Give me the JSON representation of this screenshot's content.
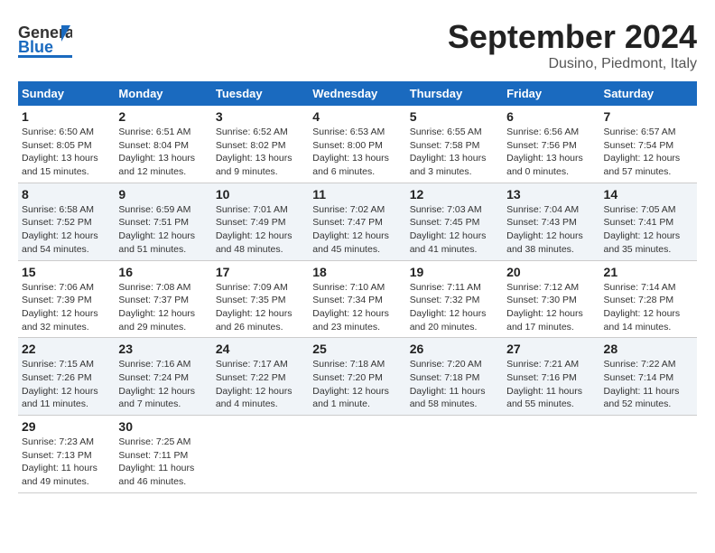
{
  "header": {
    "logo_general": "General",
    "logo_blue": "Blue",
    "month_title": "September 2024",
    "location": "Dusino, Piedmont, Italy"
  },
  "days_of_week": [
    "Sunday",
    "Monday",
    "Tuesday",
    "Wednesday",
    "Thursday",
    "Friday",
    "Saturday"
  ],
  "weeks": [
    [
      {
        "day": "1",
        "lines": [
          "Sunrise: 6:50 AM",
          "Sunset: 8:05 PM",
          "Daylight: 13 hours",
          "and 15 minutes."
        ]
      },
      {
        "day": "2",
        "lines": [
          "Sunrise: 6:51 AM",
          "Sunset: 8:04 PM",
          "Daylight: 13 hours",
          "and 12 minutes."
        ]
      },
      {
        "day": "3",
        "lines": [
          "Sunrise: 6:52 AM",
          "Sunset: 8:02 PM",
          "Daylight: 13 hours",
          "and 9 minutes."
        ]
      },
      {
        "day": "4",
        "lines": [
          "Sunrise: 6:53 AM",
          "Sunset: 8:00 PM",
          "Daylight: 13 hours",
          "and 6 minutes."
        ]
      },
      {
        "day": "5",
        "lines": [
          "Sunrise: 6:55 AM",
          "Sunset: 7:58 PM",
          "Daylight: 13 hours",
          "and 3 minutes."
        ]
      },
      {
        "day": "6",
        "lines": [
          "Sunrise: 6:56 AM",
          "Sunset: 7:56 PM",
          "Daylight: 13 hours",
          "and 0 minutes."
        ]
      },
      {
        "day": "7",
        "lines": [
          "Sunrise: 6:57 AM",
          "Sunset: 7:54 PM",
          "Daylight: 12 hours",
          "and 57 minutes."
        ]
      }
    ],
    [
      {
        "day": "8",
        "lines": [
          "Sunrise: 6:58 AM",
          "Sunset: 7:52 PM",
          "Daylight: 12 hours",
          "and 54 minutes."
        ]
      },
      {
        "day": "9",
        "lines": [
          "Sunrise: 6:59 AM",
          "Sunset: 7:51 PM",
          "Daylight: 12 hours",
          "and 51 minutes."
        ]
      },
      {
        "day": "10",
        "lines": [
          "Sunrise: 7:01 AM",
          "Sunset: 7:49 PM",
          "Daylight: 12 hours",
          "and 48 minutes."
        ]
      },
      {
        "day": "11",
        "lines": [
          "Sunrise: 7:02 AM",
          "Sunset: 7:47 PM",
          "Daylight: 12 hours",
          "and 45 minutes."
        ]
      },
      {
        "day": "12",
        "lines": [
          "Sunrise: 7:03 AM",
          "Sunset: 7:45 PM",
          "Daylight: 12 hours",
          "and 41 minutes."
        ]
      },
      {
        "day": "13",
        "lines": [
          "Sunrise: 7:04 AM",
          "Sunset: 7:43 PM",
          "Daylight: 12 hours",
          "and 38 minutes."
        ]
      },
      {
        "day": "14",
        "lines": [
          "Sunrise: 7:05 AM",
          "Sunset: 7:41 PM",
          "Daylight: 12 hours",
          "and 35 minutes."
        ]
      }
    ],
    [
      {
        "day": "15",
        "lines": [
          "Sunrise: 7:06 AM",
          "Sunset: 7:39 PM",
          "Daylight: 12 hours",
          "and 32 minutes."
        ]
      },
      {
        "day": "16",
        "lines": [
          "Sunrise: 7:08 AM",
          "Sunset: 7:37 PM",
          "Daylight: 12 hours",
          "and 29 minutes."
        ]
      },
      {
        "day": "17",
        "lines": [
          "Sunrise: 7:09 AM",
          "Sunset: 7:35 PM",
          "Daylight: 12 hours",
          "and 26 minutes."
        ]
      },
      {
        "day": "18",
        "lines": [
          "Sunrise: 7:10 AM",
          "Sunset: 7:34 PM",
          "Daylight: 12 hours",
          "and 23 minutes."
        ]
      },
      {
        "day": "19",
        "lines": [
          "Sunrise: 7:11 AM",
          "Sunset: 7:32 PM",
          "Daylight: 12 hours",
          "and 20 minutes."
        ]
      },
      {
        "day": "20",
        "lines": [
          "Sunrise: 7:12 AM",
          "Sunset: 7:30 PM",
          "Daylight: 12 hours",
          "and 17 minutes."
        ]
      },
      {
        "day": "21",
        "lines": [
          "Sunrise: 7:14 AM",
          "Sunset: 7:28 PM",
          "Daylight: 12 hours",
          "and 14 minutes."
        ]
      }
    ],
    [
      {
        "day": "22",
        "lines": [
          "Sunrise: 7:15 AM",
          "Sunset: 7:26 PM",
          "Daylight: 12 hours",
          "and 11 minutes."
        ]
      },
      {
        "day": "23",
        "lines": [
          "Sunrise: 7:16 AM",
          "Sunset: 7:24 PM",
          "Daylight: 12 hours",
          "and 7 minutes."
        ]
      },
      {
        "day": "24",
        "lines": [
          "Sunrise: 7:17 AM",
          "Sunset: 7:22 PM",
          "Daylight: 12 hours",
          "and 4 minutes."
        ]
      },
      {
        "day": "25",
        "lines": [
          "Sunrise: 7:18 AM",
          "Sunset: 7:20 PM",
          "Daylight: 12 hours",
          "and 1 minute."
        ]
      },
      {
        "day": "26",
        "lines": [
          "Sunrise: 7:20 AM",
          "Sunset: 7:18 PM",
          "Daylight: 11 hours",
          "and 58 minutes."
        ]
      },
      {
        "day": "27",
        "lines": [
          "Sunrise: 7:21 AM",
          "Sunset: 7:16 PM",
          "Daylight: 11 hours",
          "and 55 minutes."
        ]
      },
      {
        "day": "28",
        "lines": [
          "Sunrise: 7:22 AM",
          "Sunset: 7:14 PM",
          "Daylight: 11 hours",
          "and 52 minutes."
        ]
      }
    ],
    [
      {
        "day": "29",
        "lines": [
          "Sunrise: 7:23 AM",
          "Sunset: 7:13 PM",
          "Daylight: 11 hours",
          "and 49 minutes."
        ]
      },
      {
        "day": "30",
        "lines": [
          "Sunrise: 7:25 AM",
          "Sunset: 7:11 PM",
          "Daylight: 11 hours",
          "and 46 minutes."
        ]
      },
      {
        "day": "",
        "lines": []
      },
      {
        "day": "",
        "lines": []
      },
      {
        "day": "",
        "lines": []
      },
      {
        "day": "",
        "lines": []
      },
      {
        "day": "",
        "lines": []
      }
    ]
  ]
}
